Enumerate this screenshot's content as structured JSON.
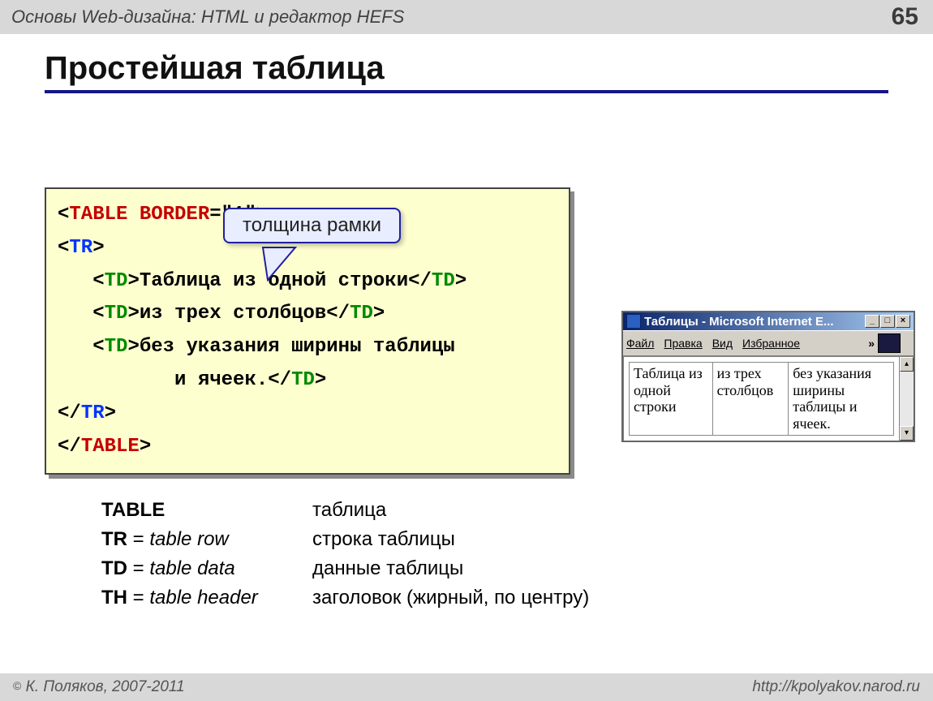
{
  "header": {
    "breadcrumb": "Основы Web-дизайна: HTML и редактор HEFS",
    "page_number": "65"
  },
  "title": "Простейшая таблица",
  "callout": "толщина рамки",
  "code": {
    "lt": "<",
    "gt": ">",
    "lts": "</",
    "eq": "=\"1\"",
    "table": "TABLE",
    "border": " BORDER",
    "tr": "TR",
    "td": "TD",
    "cell1": "Таблица из одной строки",
    "cell2": "из трех столбцов",
    "cell3a": "без указания ширины таблицы",
    "cell3b": "и ячеек."
  },
  "ie": {
    "title": "Таблицы - Microsoft Internet E...",
    "menu": {
      "file": "Файл",
      "edit": "Правка",
      "view": "Вид",
      "fav": "Избранное",
      "chev": "»"
    },
    "cells": [
      "Таблица из одной строки",
      "из трех столбцов",
      "без указания ширины таблицы и ячеек."
    ]
  },
  "defs": [
    {
      "term_bold": "TABLE",
      "term_sep": "",
      "term_ital": "",
      "desc": "таблица"
    },
    {
      "term_bold": "TR",
      "term_sep": " = ",
      "term_ital": "table row",
      "desc": "строка таблицы"
    },
    {
      "term_bold": "TD",
      "term_sep": " = ",
      "term_ital": "table data",
      "desc": "данные таблицы"
    },
    {
      "term_bold": "TH",
      "term_sep": " = ",
      "term_ital": "table header",
      "desc": "заголовок (жирный, по центру)"
    }
  ],
  "footer": {
    "left": "К. Поляков, 2007-2011",
    "right": "http://kpolyakov.narod.ru",
    "copy": "©"
  }
}
